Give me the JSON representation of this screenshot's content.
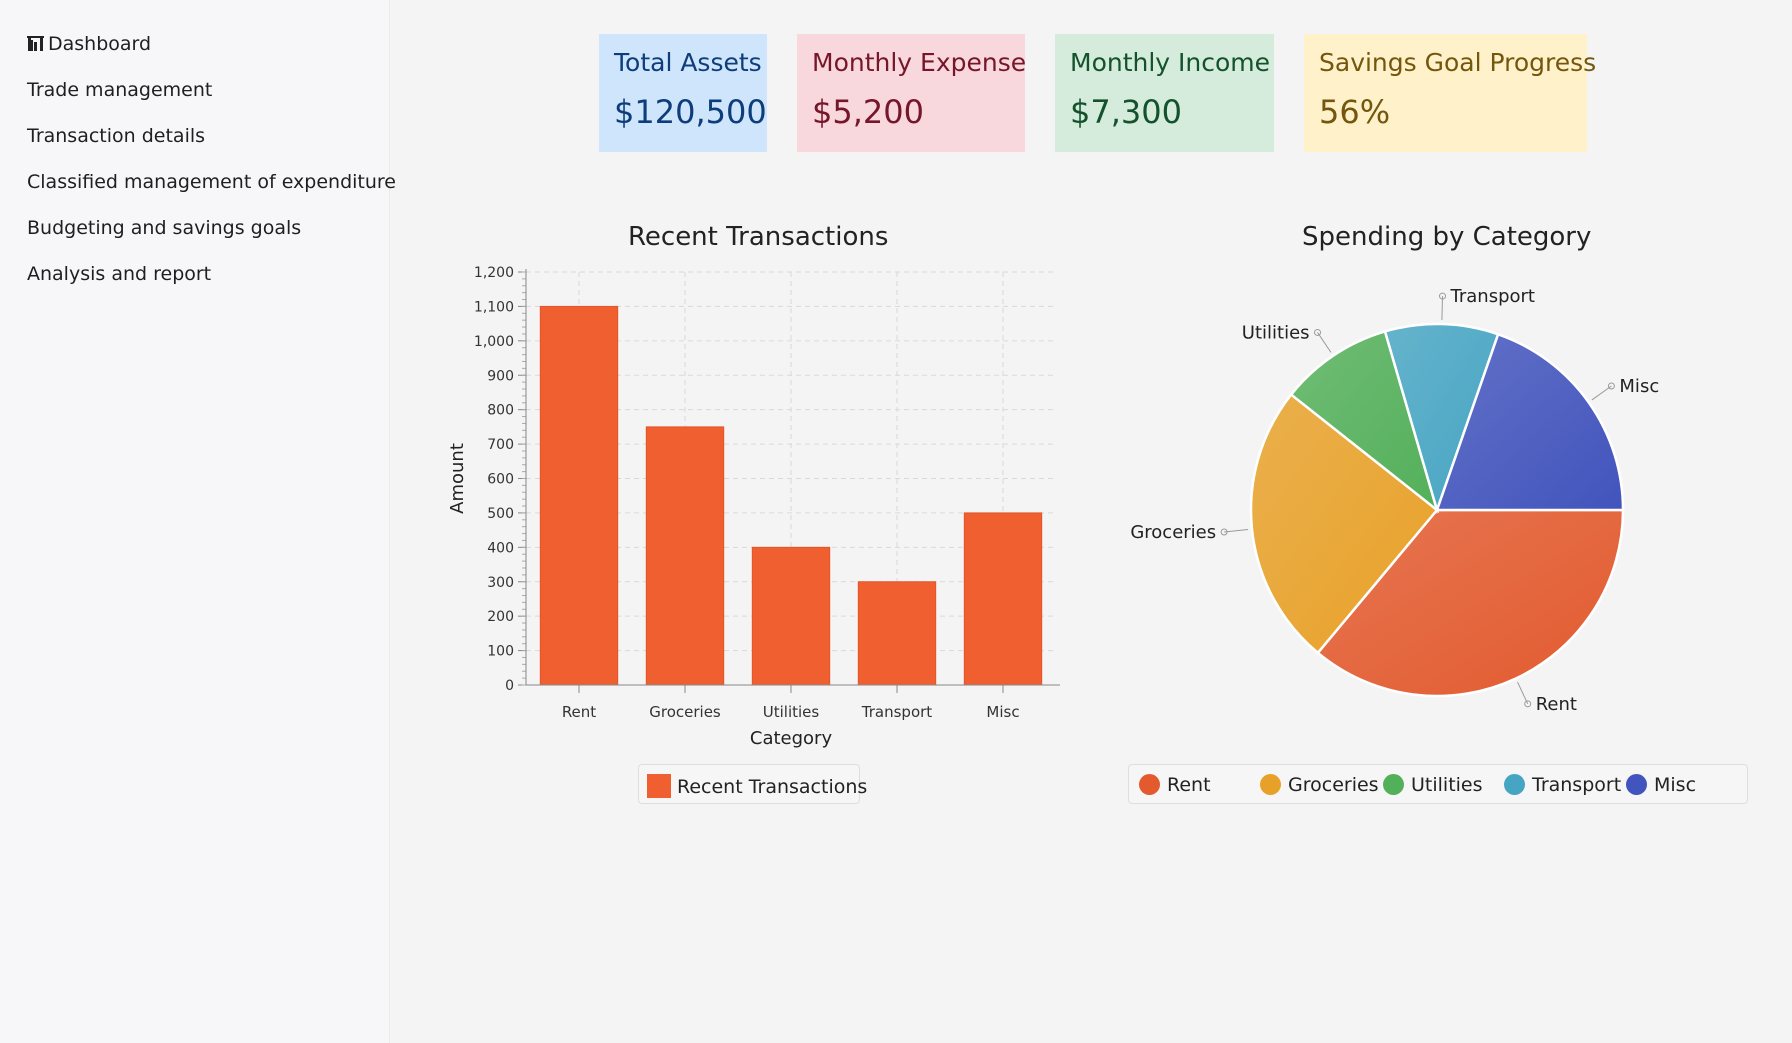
{
  "sidebar": {
    "items": [
      {
        "label": "Dashboard",
        "icon": "bar-chart-icon"
      },
      {
        "label": "Trade management"
      },
      {
        "label": "Transaction details"
      },
      {
        "label": "Classified management of expenditure"
      },
      {
        "label": "Budgeting and savings goals"
      },
      {
        "label": "Analysis and report"
      }
    ]
  },
  "cards": {
    "assets": {
      "title": "Total Assets",
      "value": "$120,500"
    },
    "expense": {
      "title": "Monthly Expense",
      "value": "$5,200"
    },
    "income": {
      "title": "Monthly Income",
      "value": "$7,300"
    },
    "savings": {
      "title": "Savings Goal Progress",
      "value": "56%"
    }
  },
  "colors": {
    "bar": "#f05f2f",
    "rent": "#e35a2e",
    "groceries": "#e8a128",
    "utilities": "#53b05a",
    "transport": "#46a5c3",
    "misc": "#4254bd"
  },
  "chart_data": [
    {
      "type": "bar",
      "title": "Recent Transactions",
      "xlabel": "Category",
      "ylabel": "Amount",
      "categories": [
        "Rent",
        "Groceries",
        "Utilities",
        "Transport",
        "Misc"
      ],
      "series": [
        {
          "name": "Recent Transactions",
          "values": [
            1100,
            750,
            400,
            300,
            500
          ]
        }
      ],
      "ylim": [
        0,
        1200
      ],
      "yticks": [
        "0",
        "100",
        "200",
        "300",
        "400",
        "500",
        "600",
        "700",
        "800",
        "900",
        "1,000",
        "1,100",
        "1,200"
      ],
      "grid": true,
      "legend": "bottom"
    },
    {
      "type": "pie",
      "title": "Spending by Category",
      "labels": [
        "Rent",
        "Groceries",
        "Utilities",
        "Transport",
        "Misc"
      ],
      "values": [
        1100,
        750,
        300,
        300,
        600
      ],
      "legend": "bottom"
    }
  ]
}
